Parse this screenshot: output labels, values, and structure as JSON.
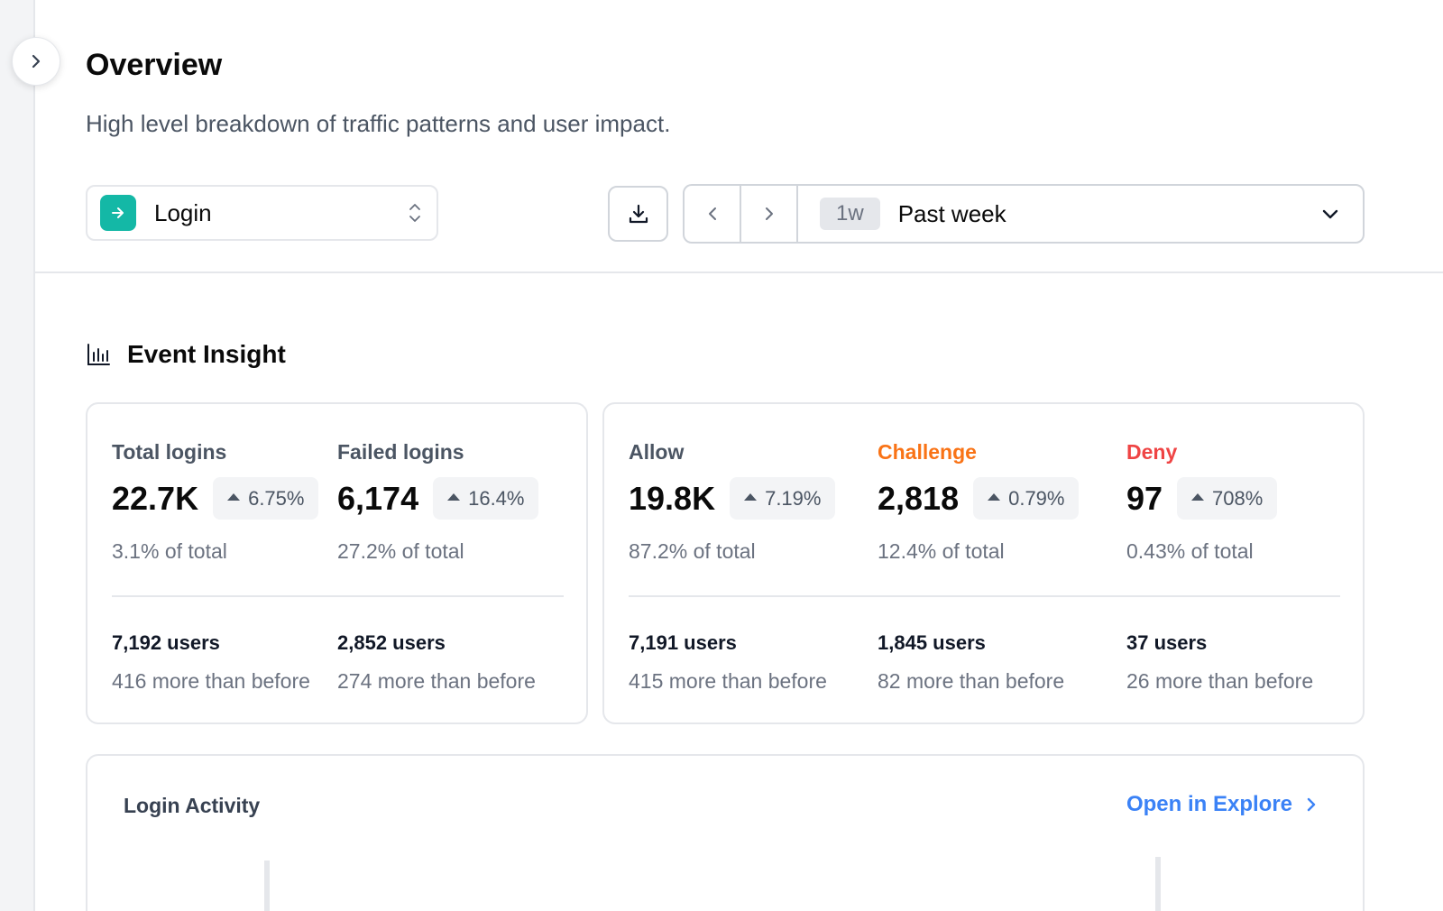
{
  "header": {
    "title": "Overview",
    "subtitle": "High level breakdown of traffic patterns and user impact."
  },
  "controls": {
    "event_select": {
      "value": "Login",
      "icon": "arrow-right-icon",
      "icon_color": "#14b8a6"
    },
    "download": {
      "icon": "download-icon"
    },
    "range": {
      "badge": "1w",
      "label": "Past week"
    }
  },
  "event_insight": {
    "title": "Event Insight",
    "logins_card": {
      "metrics": [
        {
          "label": "Total logins",
          "value": "22.7K",
          "change": "6.75%",
          "share": "3.1% of total",
          "label_color": "#4b5563"
        },
        {
          "label": "Failed logins",
          "value": "6,174",
          "change": "16.4%",
          "share": "27.2% of total",
          "label_color": "#4b5563"
        }
      ],
      "users": [
        {
          "count": "7,192 users",
          "delta": "416 more than before"
        },
        {
          "count": "2,852 users",
          "delta": "274 more than before"
        }
      ]
    },
    "decisions_card": {
      "metrics": [
        {
          "label": "Allow",
          "value": "19.8K",
          "change": "7.19%",
          "share": "87.2% of total",
          "label_color": "#4b5563"
        },
        {
          "label": "Challenge",
          "value": "2,818",
          "change": "0.79%",
          "share": "12.4% of total",
          "label_color": "#f97316"
        },
        {
          "label": "Deny",
          "value": "97",
          "change": "708%",
          "share": "0.43% of total",
          "label_color": "#ef4444"
        }
      ],
      "users": [
        {
          "count": "7,191 users",
          "delta": "415 more than before"
        },
        {
          "count": "1,845 users",
          "delta": "82 more than before"
        },
        {
          "count": "37 users",
          "delta": "26 more than before"
        }
      ]
    }
  },
  "login_activity": {
    "title": "Login Activity",
    "link_label": "Open in Explore",
    "link_color": "#3b82f6"
  }
}
